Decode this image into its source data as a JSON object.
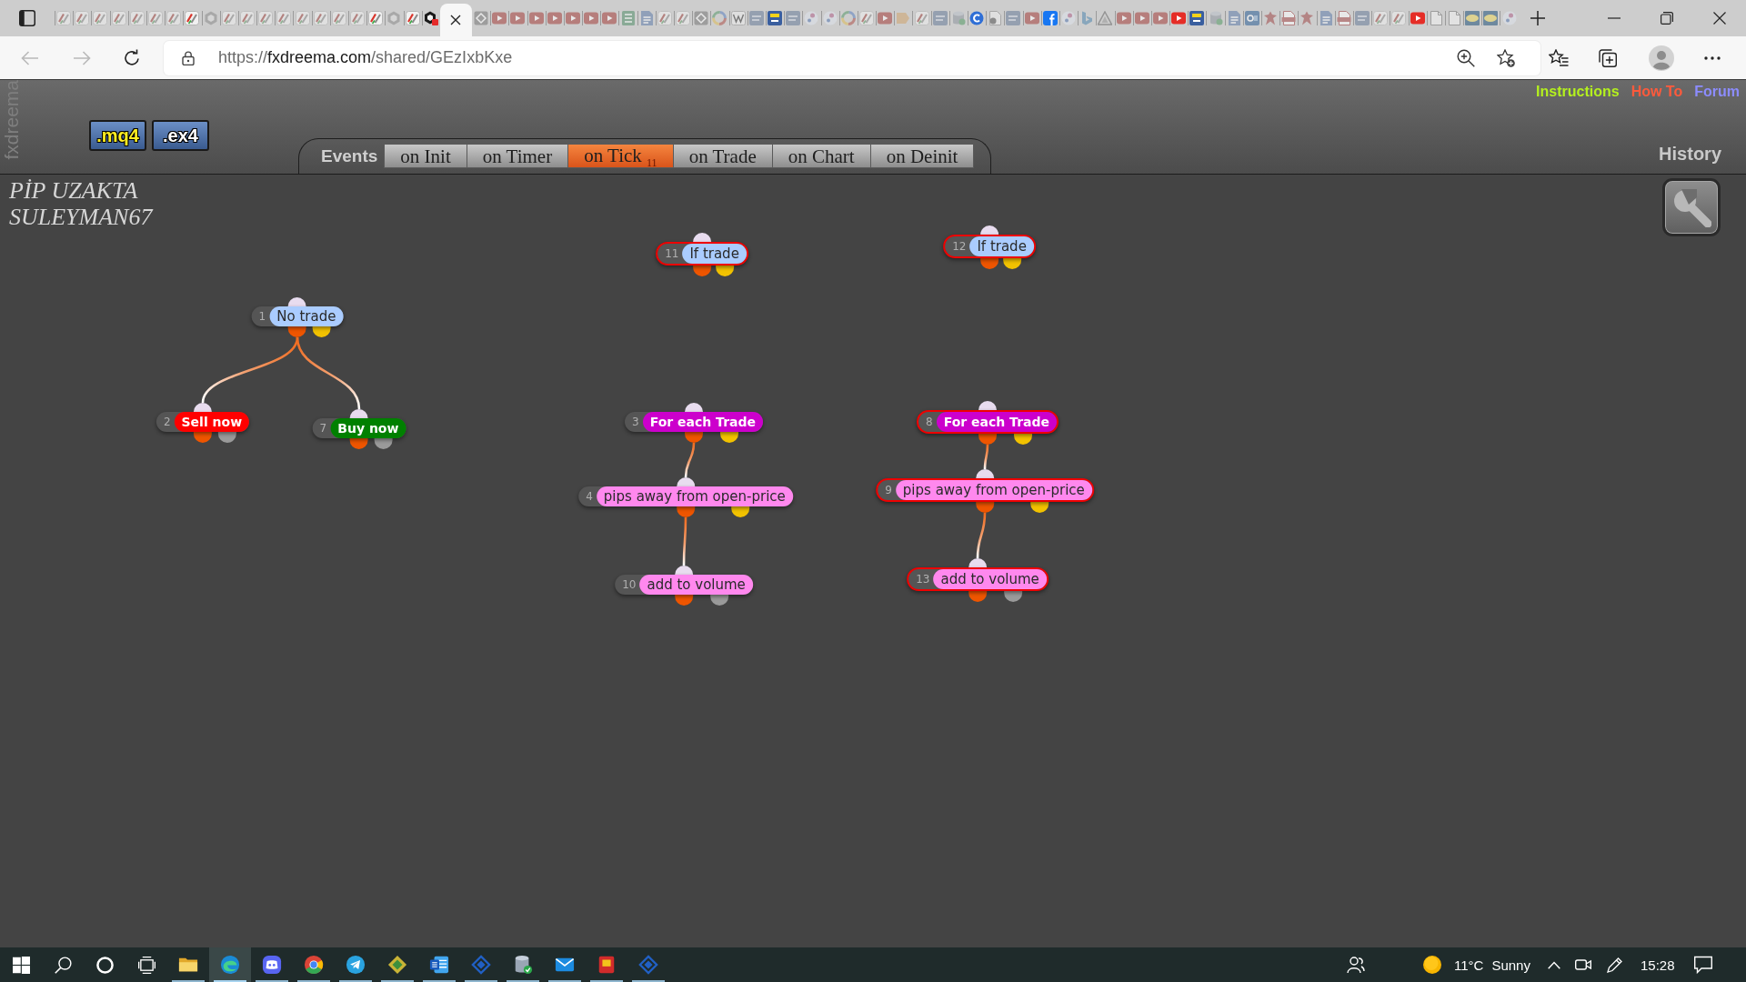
{
  "browser": {
    "tabs": [
      {
        "kind": "fx",
        "sleeping": true,
        "selected": false
      },
      {
        "kind": "fx",
        "sleeping": true,
        "selected": false
      },
      {
        "kind": "fx",
        "sleeping": true,
        "selected": false
      },
      {
        "kind": "fx",
        "sleeping": true,
        "selected": false
      },
      {
        "kind": "fx",
        "sleeping": true,
        "selected": false
      },
      {
        "kind": "fx",
        "sleeping": true,
        "selected": false
      },
      {
        "kind": "fx",
        "sleeping": true,
        "selected": false
      },
      {
        "kind": "fx",
        "sleeping": false,
        "selected": false
      },
      {
        "kind": "hex",
        "sleeping": true,
        "selected": false
      },
      {
        "kind": "fx",
        "sleeping": true,
        "selected": false
      },
      {
        "kind": "fx",
        "sleeping": true,
        "selected": false
      },
      {
        "kind": "fx",
        "sleeping": true,
        "selected": false
      },
      {
        "kind": "fx",
        "sleeping": true,
        "selected": false
      },
      {
        "kind": "fx",
        "sleeping": true,
        "selected": false
      },
      {
        "kind": "fx",
        "sleeping": true,
        "selected": false
      },
      {
        "kind": "fx",
        "sleeping": true,
        "selected": false
      },
      {
        "kind": "fx",
        "sleeping": true,
        "selected": false
      },
      {
        "kind": "fx",
        "sleeping": false,
        "selected": false
      },
      {
        "kind": "hex",
        "sleeping": true,
        "selected": false
      },
      {
        "kind": "fx",
        "sleeping": false,
        "selected": false
      },
      {
        "kind": "hexred",
        "sleeping": false,
        "selected": false
      },
      {
        "sleeping": false,
        "selected": true
      },
      {
        "kind": "diamond",
        "sleeping": true,
        "selected": false
      },
      {
        "kind": "yt",
        "sleeping": true,
        "selected": false
      },
      {
        "kind": "yt",
        "sleeping": true,
        "selected": false
      },
      {
        "kind": "yt",
        "sleeping": true,
        "selected": false
      },
      {
        "kind": "yt",
        "sleeping": true,
        "selected": false
      },
      {
        "kind": "yt",
        "sleeping": true,
        "selected": false
      },
      {
        "kind": "yt",
        "sleeping": true,
        "selected": false
      },
      {
        "kind": "yt",
        "sleeping": true,
        "selected": false
      },
      {
        "kind": "sheet",
        "sleeping": true,
        "selected": false
      },
      {
        "kind": "doc",
        "sleeping": true,
        "selected": false
      },
      {
        "kind": "fx",
        "sleeping": true,
        "selected": false
      },
      {
        "kind": "fx",
        "sleeping": true,
        "selected": false
      },
      {
        "kind": "diamond",
        "sleeping": true,
        "selected": false
      },
      {
        "kind": "google",
        "sleeping": true,
        "selected": false
      },
      {
        "kind": "wiki",
        "sleeping": true,
        "selected": false
      },
      {
        "kind": "mql",
        "sleeping": true,
        "selected": false
      },
      {
        "kind": "mq5",
        "sleeping": false,
        "selected": false
      },
      {
        "kind": "mql",
        "sleeping": true,
        "selected": false
      },
      {
        "kind": "dot",
        "sleeping": true,
        "selected": false
      },
      {
        "kind": "dot",
        "sleeping": true,
        "selected": false
      },
      {
        "kind": "google",
        "sleeping": true,
        "selected": false
      },
      {
        "kind": "fx",
        "sleeping": true,
        "selected": false
      },
      {
        "kind": "yt",
        "sleeping": true,
        "selected": false
      },
      {
        "kind": "flag",
        "sleeping": true,
        "selected": false
      },
      {
        "kind": "fx",
        "sleeping": true,
        "selected": false
      },
      {
        "kind": "mql",
        "sleeping": true,
        "selected": false
      },
      {
        "kind": "db",
        "sleeping": true,
        "selected": false
      },
      {
        "kind": "circle",
        "sleeping": false,
        "selected": false
      },
      {
        "kind": "filex",
        "sleeping": true,
        "selected": false
      },
      {
        "kind": "mql",
        "sleeping": true,
        "selected": false
      },
      {
        "kind": "yt",
        "sleeping": true,
        "selected": false
      },
      {
        "kind": "facebook",
        "sleeping": false,
        "selected": false
      },
      {
        "kind": "dot",
        "sleeping": true,
        "selected": false
      },
      {
        "kind": "bing",
        "sleeping": true,
        "selected": false
      },
      {
        "kind": "triangle",
        "sleeping": true,
        "selected": false
      },
      {
        "kind": "yt",
        "sleeping": true,
        "selected": false
      },
      {
        "kind": "yt",
        "sleeping": true,
        "selected": false
      },
      {
        "kind": "yt",
        "sleeping": true,
        "selected": false
      },
      {
        "kind": "yt",
        "sleeping": false,
        "selected": false
      },
      {
        "kind": "mq5",
        "sleeping": false,
        "selected": false
      },
      {
        "kind": "db",
        "sleeping": true,
        "selected": false
      },
      {
        "kind": "doc",
        "sleeping": true,
        "selected": false
      },
      {
        "kind": "outlook",
        "sleeping": true,
        "selected": false
      },
      {
        "kind": "lion",
        "sleeping": true,
        "selected": false
      },
      {
        "kind": "pdf",
        "sleeping": true,
        "selected": false
      },
      {
        "kind": "lion",
        "sleeping": true,
        "selected": false
      },
      {
        "kind": "doc",
        "sleeping": true,
        "selected": false
      },
      {
        "kind": "pdf",
        "sleeping": true,
        "selected": false
      },
      {
        "kind": "mql",
        "sleeping": true,
        "selected": false
      },
      {
        "kind": "fx",
        "sleeping": true,
        "selected": false
      },
      {
        "kind": "fx",
        "sleeping": true,
        "selected": false
      },
      {
        "kind": "yt",
        "sleeping": false,
        "selected": false
      },
      {
        "kind": "file",
        "sleeping": true,
        "selected": false
      },
      {
        "kind": "file",
        "sleeping": true,
        "selected": false
      },
      {
        "kind": "ikea",
        "sleeping": true,
        "selected": false
      },
      {
        "kind": "ikea",
        "sleeping": true,
        "selected": false
      },
      {
        "kind": "dot",
        "sleeping": true,
        "selected": false
      }
    ],
    "back": {
      "disabled": true
    },
    "forward": {
      "disabled": true
    },
    "url": {
      "scheme": "https://",
      "host": "fxdreema.com",
      "path": "/shared/GEzIxbKxe"
    }
  },
  "header": {
    "logo": "fxdreema",
    "exports": [
      {
        "label": ".mq4",
        "kind": "source"
      },
      {
        "label": ".ex4",
        "kind": "compiled"
      }
    ],
    "events_label": "Events",
    "event_tabs": [
      {
        "label": "on Init",
        "selected": false
      },
      {
        "label": "on Timer",
        "selected": false
      },
      {
        "label": "on Tick",
        "count": "11",
        "selected": true
      },
      {
        "label": "on Trade",
        "selected": false
      },
      {
        "label": "on Chart",
        "selected": false
      },
      {
        "label": "on Deinit",
        "selected": false
      }
    ],
    "links": [
      {
        "label": "Instructions",
        "color": "#b4f01e"
      },
      {
        "label": "How To",
        "color": "#ff5a3c"
      },
      {
        "label": "Forum",
        "color": "#8c8cff"
      }
    ],
    "history": "History"
  },
  "canvas": {
    "project_title": "PİP UZAKTA SULEYMAN67",
    "nodes": [
      {
        "number": "11",
        "label": "If trade",
        "color": "#aaccff",
        "selected": true,
        "outputs": [
          {
            "color": "#ee5500"
          },
          {
            "color": "#f2c200"
          }
        ]
      },
      {
        "number": "12",
        "label": "If trade",
        "color": "#aaccff",
        "selected": true,
        "outputs": [
          {
            "color": "#ee5500"
          },
          {
            "color": "#f2c200"
          }
        ]
      },
      {
        "number": "1",
        "label": "No trade",
        "color": "#aaccff",
        "selected": false,
        "outputs": [
          {
            "color": "#ee5500"
          },
          {
            "color": "#f2c200"
          }
        ],
        "children": [
          {
            "number": "2",
            "label": "Sell now",
            "color": "#ff0000",
            "selected": false,
            "outputs": [
              {
                "color": "#ee5500"
              },
              {
                "color": "#9a9a9a"
              }
            ]
          },
          {
            "number": "7",
            "label": "Buy now",
            "color": "#008000",
            "selected": false,
            "outputs": [
              {
                "color": "#ee5500"
              },
              {
                "color": "#9a9a9a"
              }
            ]
          }
        ]
      },
      {
        "number": "3",
        "label": "For each Trade",
        "color": "#cc00cc",
        "selected": false,
        "outputs": [
          {
            "color": "#ee5500"
          },
          {
            "color": "#f2c200"
          }
        ],
        "children": [
          {
            "number": "4",
            "label": "pips away from open-price",
            "color": "#ff88ee",
            "selected": false,
            "outputs": [
              {
                "color": "#ee5500"
              },
              {
                "color": "#f2c200"
              }
            ],
            "children": [
              {
                "number": "10",
                "label": "add to volume",
                "color": "#ff88ee",
                "selected": false,
                "outputs": [
                  {
                    "color": "#ee5500"
                  },
                  {
                    "color": "#9a9a9a"
                  }
                ]
              }
            ]
          }
        ]
      },
      {
        "number": "8",
        "label": "For each Trade",
        "color": "#cc00cc",
        "selected": true,
        "outputs": [
          {
            "color": "#ee5500"
          },
          {
            "color": "#f2c200"
          }
        ],
        "children": [
          {
            "number": "9",
            "label": "pips away from open-price",
            "color": "#ff88ee",
            "selected": true,
            "outputs": [
              {
                "color": "#ee5500"
              },
              {
                "color": "#f2c200"
              }
            ],
            "children": [
              {
                "number": "13",
                "label": "add to volume",
                "color": "#ff88ee",
                "selected": true,
                "outputs": [
                  {
                    "color": "#ee5500"
                  },
                  {
                    "color": "#9a9a9a"
                  }
                ]
              }
            ]
          }
        ]
      }
    ]
  },
  "taskbar": {
    "apps": [
      {
        "kind": "folder",
        "running": true,
        "selected": false
      },
      {
        "kind": "swirl",
        "running": true,
        "selected": true
      },
      {
        "kind": "gamepad",
        "running": true,
        "selected": false
      },
      {
        "kind": "tricolor",
        "running": true,
        "selected": false
      },
      {
        "kind": "plane",
        "running": true,
        "selected": false
      },
      {
        "kind": "gem",
        "running": true,
        "selected": false
      },
      {
        "kind": "word",
        "running": true,
        "selected": false
      },
      {
        "kind": "diamond",
        "running": true,
        "selected": false
      },
      {
        "kind": "db",
        "running": true,
        "selected": false
      },
      {
        "kind": "mail",
        "running": true,
        "selected": false
      },
      {
        "kind": "box",
        "running": true,
        "selected": false
      },
      {
        "kind": "diamond",
        "running": true,
        "selected": false
      }
    ],
    "weather": {
      "temperature": "11°C",
      "condition": "Sunny"
    },
    "time": "15:28"
  }
}
